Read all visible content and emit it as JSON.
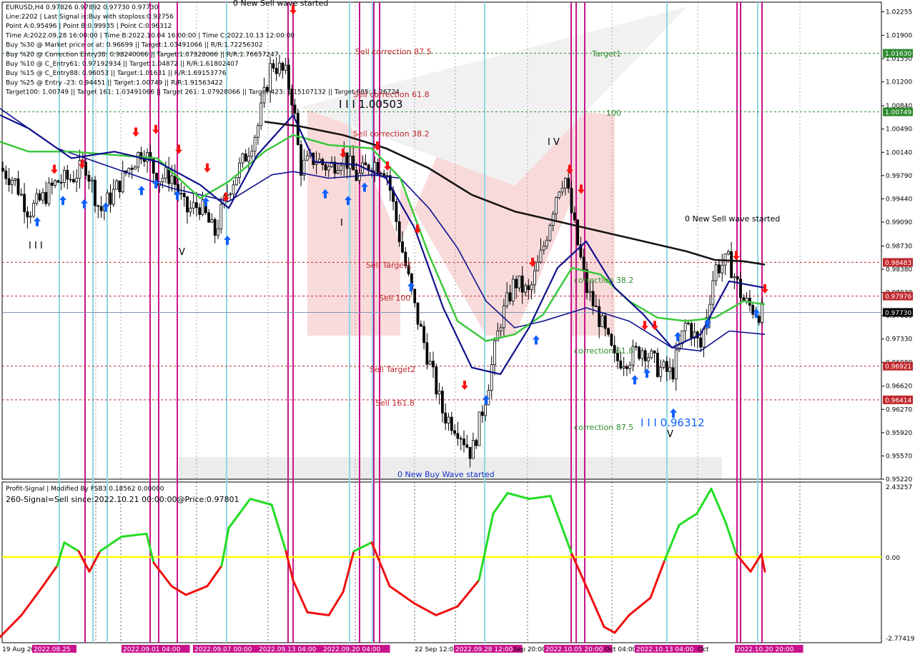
{
  "header": {
    "symbol_line": "EURUSD,H4  0.97826 0.97892 0.97730 0.97730",
    "info_lines": [
      "Line:2202 | Last Signal is:Buy with stoploss:0.92756",
      "Point A:0.95496 | Point B:0.99935 | Point C:0.96312",
      "Time A:2022.09.28 16:00:00 | Time B:2022.10.04 16:00:00 | Time C:2022.10.13 12:00:00",
      "Buy %30 @ Market price or at: 0.96699 || Target:1.03491066 || R/R:1.72256302",
      "Buy %20 @ Correction Entry38: 0.98240066 || Target:1.07928066 || R/R:1.76657247",
      "Buy %10 @ C_Entry61: 0.97192934 || Target:1.04872 || R/R:1.61802407",
      "Buy %15 @ C_Entry88: 0.96053 || Target:1.01631 || R/R:1.69153776",
      "Buy %25 @ Entry -23: 0.94451 || Target:1.00749 || R/R:1.91563422",
      "Target100: 1.00749 || Target 161: 1.03491066 || Target 261: 1.07928066 || Target 423: 1.15107132 || Target 685: 1.26724"
    ]
  },
  "annotations": {
    "new_sell_wave_top": "0 New Sell wave started",
    "new_sell_wave_right": "0 New Sell wave started",
    "new_buy_wave": "0 New Buy Wave started",
    "sell_correction_875": "Sell correction 87.5",
    "sell_correction_618": "Sell correction 61.8",
    "sell_correction_382": "Sell correction 38.2",
    "sell_target1": "Sell Target1",
    "sell_100": "Sell 100",
    "sell_target2": "Sell Target2",
    "sell_1618": "Sell 161.8",
    "target1": "Target1",
    "label_100": "100",
    "correction_382": "correction 38.2",
    "correction_618": "correction 61.8",
    "correction_875": "correction 87.5",
    "wave_level_high": "I I I 1.00503",
    "wave_level_low": "I I I 0.96312",
    "roman_iv": "I V",
    "roman_v": "V",
    "roman_v2": "V",
    "roman_iii": "I I I",
    "roman_i": "I"
  },
  "price_axis": {
    "ticks": [
      "1.02255",
      "1.01900",
      "1.01550",
      "1.01200",
      "1.00840",
      "1.00490",
      "1.00140",
      "0.99790",
      "0.99440",
      "0.99090",
      "0.98730",
      "0.98380",
      "0.98030",
      "0.97680",
      "0.97330",
      "0.96980",
      "0.96620",
      "0.96270",
      "0.95920",
      "0.95570",
      "0.95220"
    ],
    "badges": [
      {
        "value": "1.01630",
        "color": "#2e8b2e"
      },
      {
        "value": "1.00749",
        "color": "#2e8b2e"
      },
      {
        "value": "0.98483",
        "color": "#c0282d"
      },
      {
        "value": "0.97976",
        "color": "#c0282d"
      },
      {
        "value": "0.97730",
        "color": "#000000"
      },
      {
        "value": "0.96921",
        "color": "#c0282d"
      },
      {
        "value": "0.96414",
        "color": "#c0282d"
      }
    ]
  },
  "indicator": {
    "title": "Profit-Signal | Modified By FSB3  0.18562 0.00000",
    "signal_line": "260-Signal=Sell since:2022.10.21 00:00:00@Price:0.97801",
    "ticks": [
      "2.43257",
      "0.00",
      "-2.77419"
    ]
  },
  "time_axis": {
    "labels": [
      "19 Aug 2022",
      "2022.08.25",
      "2022.09.01 04:00",
      "2022.09.07 00:00",
      "2022.09.13 04:00",
      "2022.09.20 04:00",
      "22 Sep 12:00",
      "2022.09.28 12:00",
      "Sep 20:00",
      "2022.10.05 20:00",
      "Oct 04:00",
      "2022.10.13 04:00",
      "Oct",
      "2022.10.20 20:00"
    ]
  },
  "colors": {
    "candle": "#000000",
    "green_ma": "#3cc83c",
    "navy_ma": "#10108c",
    "black_ma": "#141414",
    "magenta_line": "#c8148c",
    "cyan_line": "#8ed8e6",
    "buy_arrow": "#1060ff",
    "sell_arrow": "#ff1010",
    "signal_up": "#22dd22",
    "signal_down": "#ee1111",
    "zero_line": "#ffff00"
  },
  "chart_data": {
    "type": "candlestick",
    "symbol": "EURUSD",
    "timeframe": "H4",
    "ylim": [
      0.9522,
      1.024
    ],
    "x_range": [
      "2022-08-19",
      "2022-10-21"
    ],
    "horizontal_levels": [
      1.0163,
      1.00749,
      0.98483,
      0.97976,
      0.9773,
      0.96921,
      0.96414
    ],
    "close_path": [
      [
        0,
        0.999
      ],
      [
        20,
        0.9972
      ],
      [
        40,
        0.9925
      ],
      [
        60,
        0.9945
      ],
      [
        80,
        0.997
      ],
      [
        100,
        0.9975
      ],
      [
        120,
        0.9995
      ],
      [
        140,
        0.9925
      ],
      [
        160,
        0.9955
      ],
      [
        180,
        0.999
      ],
      [
        200,
        1.002
      ],
      [
        220,
        0.9975
      ],
      [
        240,
        0.998
      ],
      [
        260,
        0.9925
      ],
      [
        280,
        0.9935
      ],
      [
        300,
        0.989
      ],
      [
        320,
        0.996
      ],
      [
        340,
        1.0
      ],
      [
        360,
        1.005
      ],
      [
        380,
        1.015
      ],
      [
        400,
        1.013
      ],
      [
        410,
        1.009
      ],
      [
        420,
        0.999
      ],
      [
        440,
        1.0005
      ],
      [
        460,
        0.999
      ],
      [
        480,
        1.001
      ],
      [
        500,
        0.9975
      ],
      [
        520,
        1.0
      ],
      [
        540,
        0.999
      ],
      [
        560,
        0.988
      ],
      [
        580,
        0.978
      ],
      [
        600,
        0.97
      ],
      [
        620,
        0.962
      ],
      [
        640,
        0.96
      ],
      [
        660,
        0.956
      ],
      [
        680,
        0.965
      ],
      [
        700,
        0.976
      ],
      [
        720,
        0.982
      ],
      [
        740,
        0.98
      ],
      [
        760,
        0.987
      ],
      [
        780,
        0.996
      ],
      [
        790,
        0.998
      ],
      [
        800,
        0.992
      ],
      [
        820,
        0.981
      ],
      [
        840,
        0.976
      ],
      [
        860,
        0.97
      ],
      [
        880,
        0.9705
      ],
      [
        900,
        0.972
      ],
      [
        920,
        0.969
      ],
      [
        940,
        0.968
      ],
      [
        960,
        0.976
      ],
      [
        980,
        0.972
      ],
      [
        1000,
        0.984
      ],
      [
        1020,
        0.985
      ],
      [
        1040,
        0.979
      ],
      [
        1060,
        0.9773
      ]
    ],
    "green_ma": [
      [
        0,
        1.003
      ],
      [
        40,
        1.0015
      ],
      [
        100,
        1.0015
      ],
      [
        160,
        1.001
      ],
      [
        220,
        1.0005
      ],
      [
        280,
        0.9945
      ],
      [
        320,
        0.997
      ],
      [
        370,
        1.0015
      ],
      [
        410,
        1.004
      ],
      [
        460,
        1.0025
      ],
      [
        520,
        1.002
      ],
      [
        560,
        0.9975
      ],
      [
        600,
        0.986
      ],
      [
        640,
        0.976
      ],
      [
        680,
        0.973
      ],
      [
        720,
        0.974
      ],
      [
        760,
        0.977
      ],
      [
        800,
        0.984
      ],
      [
        840,
        0.983
      ],
      [
        880,
        0.979
      ],
      [
        920,
        0.9765
      ],
      [
        960,
        0.976
      ],
      [
        1000,
        0.9765
      ],
      [
        1040,
        0.979
      ],
      [
        1070,
        0.9785
      ]
    ],
    "navy_fast": [
      [
        0,
        1.007
      ],
      [
        40,
        1.005
      ],
      [
        100,
        1.0005
      ],
      [
        160,
        1.0015
      ],
      [
        220,
        1.0
      ],
      [
        280,
        0.9965
      ],
      [
        320,
        0.993
      ],
      [
        360,
        1.001
      ],
      [
        410,
        1.007
      ],
      [
        440,
        1.0
      ],
      [
        500,
        0.9995
      ],
      [
        540,
        0.9975
      ],
      [
        580,
        0.99
      ],
      [
        620,
        0.978
      ],
      [
        660,
        0.969
      ],
      [
        700,
        0.968
      ],
      [
        740,
        0.975
      ],
      [
        780,
        0.984
      ],
      [
        820,
        0.988
      ],
      [
        860,
        0.981
      ],
      [
        900,
        0.977
      ],
      [
        940,
        0.972
      ],
      [
        980,
        0.974
      ],
      [
        1020,
        0.982
      ],
      [
        1070,
        0.981
      ]
    ],
    "navy_slow": [
      [
        0,
        1.008
      ],
      [
        80,
        1.002
      ],
      [
        160,
        0.999
      ],
      [
        240,
        0.996
      ],
      [
        320,
        0.994
      ],
      [
        380,
        0.998
      ],
      [
        410,
        0.9985
      ],
      [
        460,
        0.9975
      ],
      [
        520,
        0.998
      ],
      [
        560,
        0.9975
      ],
      [
        600,
        0.993
      ],
      [
        640,
        0.987
      ],
      [
        680,
        0.979
      ],
      [
        720,
        0.975
      ],
      [
        760,
        0.976
      ],
      [
        820,
        0.978
      ],
      [
        880,
        0.976
      ],
      [
        940,
        0.972
      ],
      [
        980,
        0.9715
      ],
      [
        1020,
        0.9745
      ],
      [
        1070,
        0.974
      ]
    ],
    "black_ma": [
      [
        370,
        1.006
      ],
      [
        420,
        1.0053
      ],
      [
        480,
        1.004
      ],
      [
        540,
        1.002
      ],
      [
        600,
        0.999
      ],
      [
        660,
        0.995
      ],
      [
        720,
        0.9925
      ],
      [
        780,
        0.991
      ],
      [
        840,
        0.9895
      ],
      [
        900,
        0.988
      ],
      [
        960,
        0.9865
      ],
      [
        1000,
        0.9852
      ],
      [
        1040,
        0.985
      ],
      [
        1070,
        0.9845
      ]
    ],
    "signal": [
      [
        0,
        -2.75
      ],
      [
        30,
        -2.0
      ],
      [
        60,
        -1.0
      ],
      [
        80,
        -0.3
      ],
      [
        90,
        0.5
      ],
      [
        110,
        0.2
      ],
      [
        125,
        -0.5
      ],
      [
        140,
        0.2
      ],
      [
        170,
        0.7
      ],
      [
        205,
        0.8
      ],
      [
        215,
        -0.2
      ],
      [
        240,
        -1.0
      ],
      [
        260,
        -1.3
      ],
      [
        290,
        -1.0
      ],
      [
        310,
        -0.3
      ],
      [
        320,
        1.0
      ],
      [
        350,
        2.0
      ],
      [
        380,
        1.8
      ],
      [
        400,
        0.2
      ],
      [
        410,
        -0.8
      ],
      [
        430,
        -1.9
      ],
      [
        460,
        -2.0
      ],
      [
        480,
        -1.2
      ],
      [
        495,
        0.2
      ],
      [
        520,
        0.5
      ],
      [
        545,
        -1.0
      ],
      [
        580,
        -1.6
      ],
      [
        610,
        -2.0
      ],
      [
        640,
        -1.7
      ],
      [
        670,
        -0.8
      ],
      [
        690,
        1.5
      ],
      [
        710,
        2.2
      ],
      [
        740,
        2.0
      ],
      [
        770,
        2.1
      ],
      [
        800,
        0.1
      ],
      [
        820,
        -1.0
      ],
      [
        845,
        -2.4
      ],
      [
        860,
        -2.6
      ],
      [
        880,
        -2.0
      ],
      [
        910,
        -1.4
      ],
      [
        930,
        -0.1
      ],
      [
        950,
        1.1
      ],
      [
        975,
        1.5
      ],
      [
        995,
        2.35
      ],
      [
        1015,
        1.2
      ],
      [
        1030,
        0.1
      ],
      [
        1050,
        -0.5
      ],
      [
        1065,
        0.1
      ],
      [
        1070,
        -0.5
      ]
    ],
    "buy_arrows": [
      [
        52,
        0.9908
      ],
      [
        88,
        0.994
      ],
      [
        118,
        0.9935
      ],
      [
        148,
        0.993
      ],
      [
        198,
        0.9955
      ],
      [
        218,
        0.9965
      ],
      [
        248,
        0.9948
      ],
      [
        288,
        0.9938
      ],
      [
        318,
        0.988
      ],
      [
        455,
        0.995
      ],
      [
        487,
        0.994
      ],
      [
        510,
        0.996
      ],
      [
        575,
        0.981
      ],
      [
        680,
        0.964
      ],
      [
        750,
        0.973
      ],
      [
        888,
        0.967
      ],
      [
        905,
        0.968
      ],
      [
        942,
        0.962
      ],
      [
        948,
        0.9735
      ],
      [
        990,
        0.9755
      ],
      [
        1058,
        0.977
      ]
    ],
    "sell_arrows": [
      [
        76,
        0.999
      ],
      [
        115,
        0.9998
      ],
      [
        190,
        1.0046
      ],
      [
        218,
        1.005
      ],
      [
        250,
        1.002
      ],
      [
        290,
        0.9992
      ],
      [
        316,
        0.9948
      ],
      [
        410,
        1.023
      ],
      [
        480,
        1.0014
      ],
      [
        528,
        1.0025
      ],
      [
        542,
        0.9995
      ],
      [
        584,
        0.99
      ],
      [
        650,
        0.9665
      ],
      [
        745,
        0.985
      ],
      [
        797,
        0.999
      ],
      [
        813,
        0.996
      ],
      [
        902,
        0.9755
      ],
      [
        916,
        0.9755
      ],
      [
        1030,
        0.986
      ],
      [
        1070,
        0.981
      ]
    ],
    "vertical_magenta_x": [
      119,
      210,
      222,
      248,
      403,
      410,
      503,
      523,
      531,
      799,
      806,
      818,
      1031,
      1036,
      1066
    ],
    "vertical_cyan_x": [
      83,
      130,
      150,
      317,
      489,
      521,
      678,
      933,
      1060
    ],
    "dotted_time_x": [
      134,
      169,
      275,
      375,
      497,
      580,
      637,
      738,
      856,
      976,
      1119
    ]
  }
}
